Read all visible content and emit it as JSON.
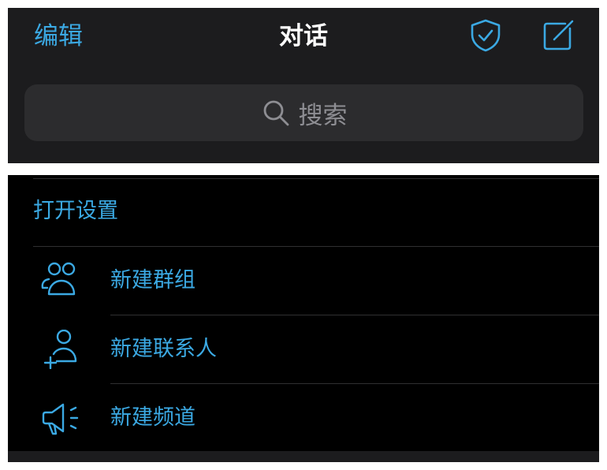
{
  "header": {
    "edit_label": "编辑",
    "title": "对话",
    "shield_icon": "shield-check-icon",
    "compose_icon": "compose-icon"
  },
  "search": {
    "placeholder": "搜索",
    "icon": "search-icon"
  },
  "menu": {
    "open_settings_label": "打开设置",
    "items": [
      {
        "label": "新建群组",
        "icon": "group-icon"
      },
      {
        "label": "新建联系人",
        "icon": "add-contact-icon"
      },
      {
        "label": "新建频道",
        "icon": "megaphone-icon"
      }
    ]
  },
  "colors": {
    "accent": "#3ba9e3",
    "header_bg": "#1c1c1e",
    "search_bg": "#2c2c2e",
    "menu_bg": "#000000",
    "placeholder": "#8e8e93"
  }
}
